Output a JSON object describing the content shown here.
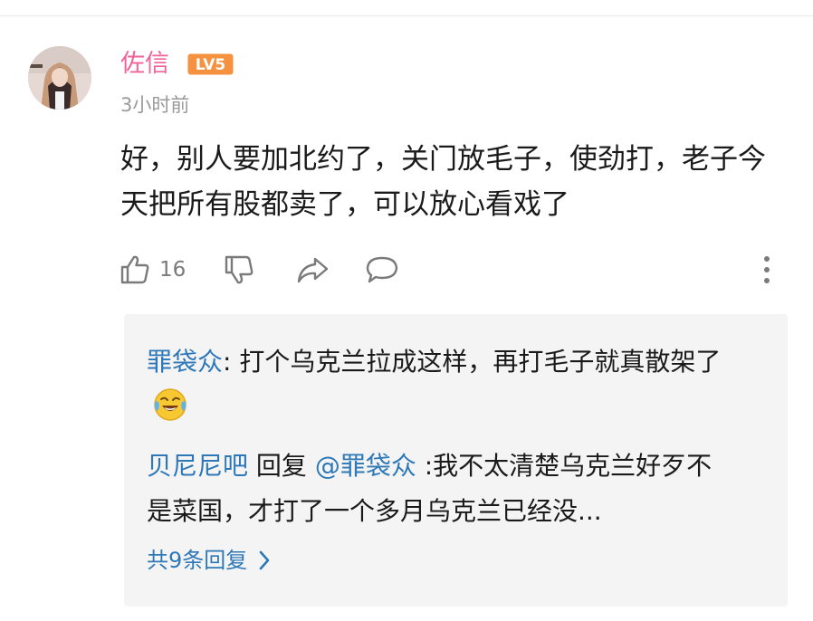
{
  "comment": {
    "username": "佐信",
    "level_badge": "LV5",
    "timestamp": "3小时前",
    "body": "好，别人要加北约了，关门放毛子，使劲打，老子今天把所有股都卖了，可以放心看戏了",
    "like_count": "16",
    "icons": {
      "like": "thumbs-up-icon",
      "dislike": "thumbs-down-icon",
      "share": "share-icon",
      "reply": "comment-bubble-icon",
      "more": "more-vertical-icon"
    }
  },
  "replies": [
    {
      "user": "罪袋众",
      "separator": ": ",
      "text": "打个乌克兰拉成这样，再打毛子就真散架了",
      "emoji": "crying-laughing-emoji"
    },
    {
      "user": "贝尼尼吧",
      "reply_word": " 回复 ",
      "mention": "@罪袋众",
      "text": " :我不太清楚乌克兰好歹不是菜国，才打了一个多月乌克兰已经没..."
    }
  ],
  "more_replies_label": "共9条回复",
  "colors": {
    "username": "#f0639a",
    "link_blue": "#2e78b7",
    "badge_orange": "#f6923f",
    "reply_bg": "#f4f4f4",
    "icon_gray": "#7a7a7a"
  }
}
